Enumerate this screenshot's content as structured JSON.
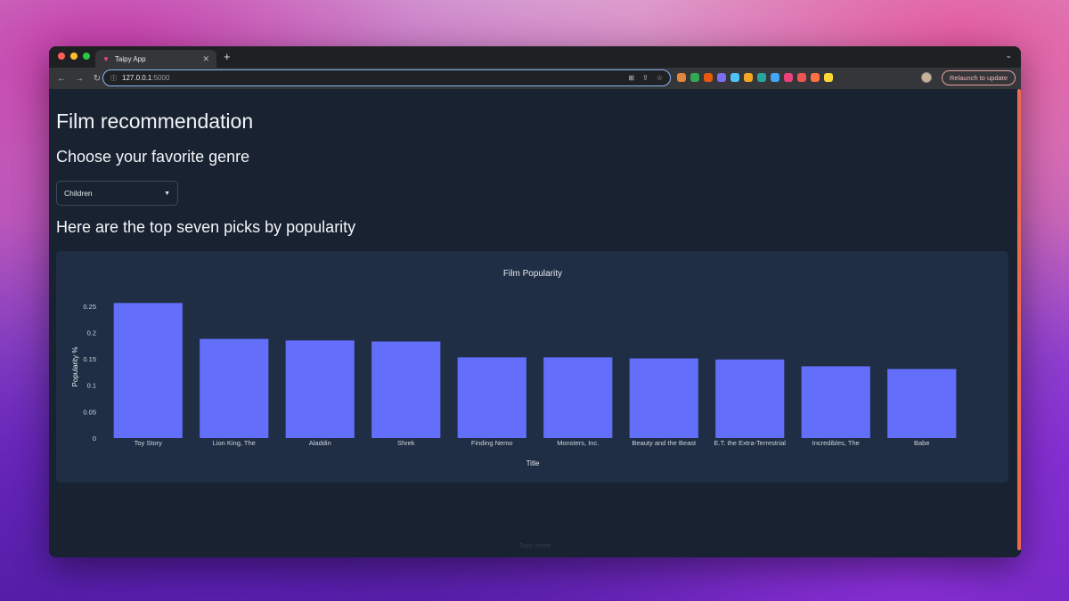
{
  "browser": {
    "tab_title": "Taipy App",
    "url_host": "127.0.0.1",
    "url_port": ":5000",
    "relaunch_label": "Relaunch to update",
    "window_controls": [
      "close",
      "minimize",
      "maximize"
    ],
    "extension_colors": [
      "#e2863b",
      "#33a852",
      "#e8590c",
      "#7c6cf0",
      "#4fc3f7",
      "#f5a623",
      "#26a69a",
      "#42a5f5",
      "#ec407a",
      "#ef5350",
      "#ff7043",
      "#fdd835"
    ]
  },
  "page": {
    "title": "Film recommendation",
    "genre_heading": "Choose your favorite genre",
    "genre_selected": "Children",
    "picks_heading": "Here are the top seven picks by popularity",
    "footer": "Taipy inside"
  },
  "colors": {
    "background": "#182231",
    "card": "#1f2e44",
    "bar": "#636efa",
    "accent": "#ee6a4d"
  },
  "chart_data": {
    "type": "bar",
    "title": "Film Popularity",
    "xlabel": "Title",
    "ylabel": "Popularity %",
    "categories": [
      "Toy Story",
      "Lion King, The",
      "Aladdin",
      "Shrek",
      "Finding Nemo",
      "Monsters, Inc.",
      "Beauty and the Beast",
      "E.T. the Extra-Terrestrial",
      "Incredibles, The",
      "Babe"
    ],
    "values": [
      0.256,
      0.188,
      0.185,
      0.183,
      0.153,
      0.153,
      0.151,
      0.149,
      0.136,
      0.131
    ],
    "yticks": [
      "0",
      "0.05",
      "0.1",
      "0.15",
      "0.2",
      "0.25"
    ],
    "ylim": [
      0,
      0.27
    ],
    "grid": false,
    "bar_color": "#636efa"
  }
}
